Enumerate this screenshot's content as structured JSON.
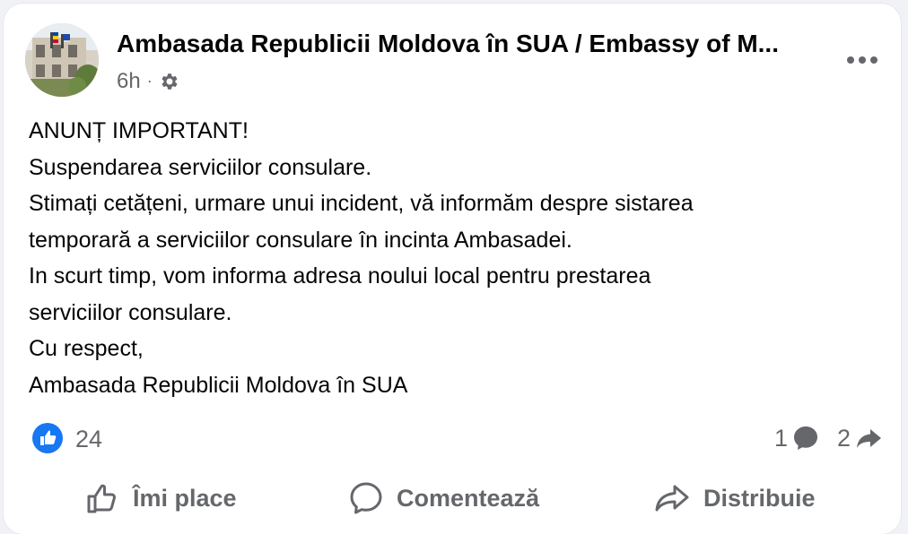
{
  "post": {
    "page_name": "Ambasada Republicii Moldova în SUA / Embassy of M...",
    "time_ago": "6h",
    "separator": "·",
    "audience_icon": "gear-icon",
    "body_lines": [
      "ANUNȚ IMPORTANT!",
      "Suspendarea serviciilor consulare.",
      "Stimați cetățeni, urmare unui incident, vă informăm despre sistarea",
      "temporară a serviciilor consulare în incinta Ambasadei.",
      "In scurt timp, vom informa adresa noului local pentru prestarea",
      "serviciilor consulare.",
      "Cu respect,",
      "Ambasada Republicii Moldova în SUA"
    ]
  },
  "stats": {
    "reactions_count": "24",
    "comments_count": "1",
    "shares_count": "2"
  },
  "actions": {
    "like_label": "Îmi place",
    "comment_label": "Comentează",
    "share_label": "Distribuie"
  },
  "colors": {
    "text_primary": "#050505",
    "text_secondary": "#65676b",
    "like_blue": "#1877f2",
    "card_bg": "#ffffff",
    "page_bg": "#f0f2f5"
  }
}
